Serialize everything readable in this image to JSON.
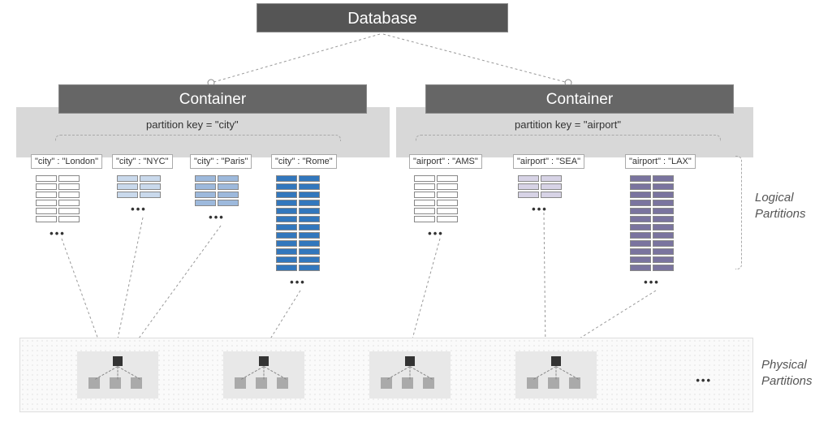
{
  "database_label": "Database",
  "containers": [
    {
      "label": "Container",
      "partition_key_text": "partition key = \"city\""
    },
    {
      "label": "Container",
      "partition_key_text": "partition key = \"airport\""
    }
  ],
  "logical_partitions_label": "Logical\nPartitions",
  "physical_partitions_label": "Physical\nPartitions",
  "ellipsis": "•••",
  "city_partitions": [
    {
      "label": "\"city\" : \"London\"",
      "style": "white",
      "rows": 6
    },
    {
      "label": "\"city\" : \"NYC\"",
      "style": "light-blue",
      "rows": 3
    },
    {
      "label": "\"city\" : \"Paris\"",
      "style": "blue",
      "rows": 4
    },
    {
      "label": "\"city\" : \"Rome\"",
      "style": "dark-blue",
      "rows": 12
    }
  ],
  "airport_partitions": [
    {
      "label": "\"airport\" : \"AMS\"",
      "style": "white",
      "rows": 6
    },
    {
      "label": "\"airport\" : \"SEA\"",
      "style": "lav",
      "rows": 3
    },
    {
      "label": "\"airport\" : \"LAX\"",
      "style": "purple",
      "rows": 12
    }
  ],
  "physical_node_count": 4
}
